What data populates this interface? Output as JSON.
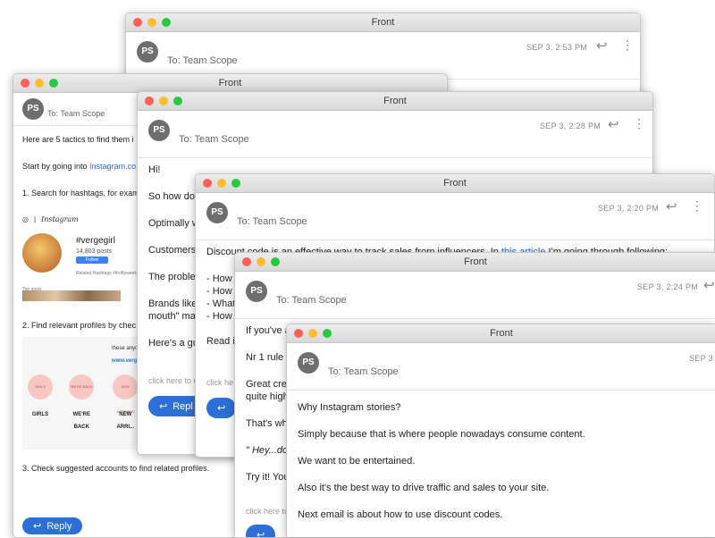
{
  "app_title": "Front",
  "windows": [
    {
      "title": "Front",
      "avatar": "PS",
      "to": "To: Team Scope",
      "date": "SEP 3, 2:53 PM"
    },
    {
      "title": "Front",
      "avatar": "PS",
      "to": "To: Team Scope",
      "lines": [
        "Here are 5 tactics to find them i",
        "Start by going into ",
        "Instagram.co",
        "1. Search for hashtags, for exam",
        "2. Find relevant profiles by chec",
        "3. Check suggested accounts to find related profiles."
      ],
      "ig": {
        "brand": "Instagram",
        "hashtag": "#vergegirl",
        "posts": "14,803 posts",
        "follow": "Follow",
        "related": "Related Hashtags #thriftyweekly #vergirl",
        "top_posts": "Top posts",
        "panel_text": "these anyo",
        "panel_link": "www.verg",
        "circles": [
          {
            "inner": "GIRLS",
            "label": "GIRLS"
          },
          {
            "inner": "WE'RE BACK",
            "label": "WE'RE BACK"
          },
          {
            "inner": "NEW ARRIVALS",
            "label": "NEW ARRI..."
          }
        ]
      },
      "reply": "Reply"
    },
    {
      "title": "Front",
      "avatar": "PS",
      "to": "To: Team Scope",
      "date": "SEP 3, 2:28 PM",
      "lines": [
        "Hi!",
        "So how do",
        "Optimally w",
        "Customers",
        "The proble",
        "Brands like",
        "mouth\" ma",
        "Here's a gu"
      ],
      "click_here": "click here to u",
      "reply": "Repl"
    },
    {
      "title": "Front",
      "avatar": "PS",
      "to": "To: Team Scope",
      "date": "SEP 3, 2:20 PM",
      "line1_pre": "Discount code is an effective way to track sales from influencers. In ",
      "line1_link": "this article",
      "line1_post": " I'm going through following:",
      "bullets": [
        "- How",
        "- How",
        "- What",
        "- How"
      ],
      "read": "Read i",
      "click_here": "click he"
    },
    {
      "title": "Front",
      "avatar": "PS",
      "to": "To: Team Scope",
      "date": "SEP 3, 2:24 PM",
      "lines": [
        "If you've al",
        "Nr 1 rule w",
        "Great crea",
        "quite high",
        "That's wh",
        "\" Hey...do",
        "Try it! You"
      ],
      "click_here": "click here to"
    },
    {
      "title": "Front",
      "avatar": "PS",
      "to": "To: Team Scope",
      "date": "SEP 3",
      "lines": [
        "Why Instagram stories?",
        "Simply because that is where people nowadays consume content.",
        "We want to be entertained.",
        "Also it's the best way to drive traffic and sales to your site.",
        "Next email is about how to use discount codes."
      ]
    }
  ]
}
